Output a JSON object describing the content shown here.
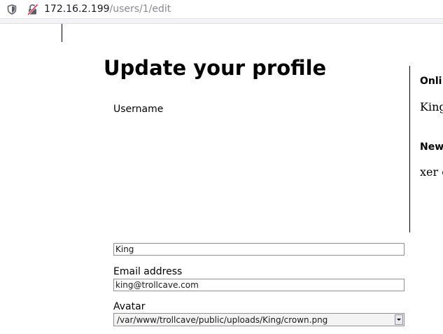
{
  "browser": {
    "url_host": "172.16.2.199",
    "url_path": "/users/1/edit"
  },
  "page": {
    "title": "Update your profile"
  },
  "form": {
    "username": {
      "label": "Username",
      "value": "King"
    },
    "email": {
      "label": "Email address",
      "value": "king@trollcave.com"
    },
    "avatar": {
      "label": "Avatar",
      "selected": "/var/www/trollcave/public/uploads/King/crown.png"
    }
  },
  "sidebar": {
    "online_heading": "Onli",
    "online_text": "King cool",
    "news_heading": "New",
    "news_text": "xer only anyl"
  },
  "colors": {
    "input_border": "#8f8f9d",
    "select_background": "#f3f3f4",
    "url_path": "#8a8a90"
  },
  "icons": {
    "tracking": "shield-icon",
    "connection": "insecure-lock-icon",
    "select_arrow": "chevron-down-icon"
  }
}
